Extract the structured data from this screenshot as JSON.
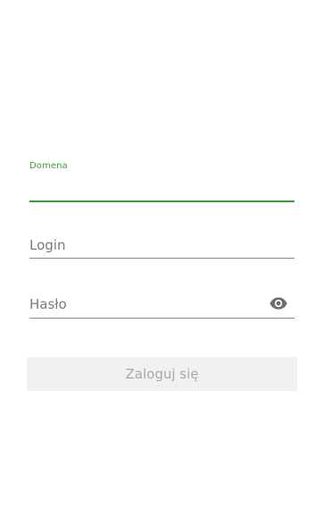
{
  "form": {
    "domain": {
      "label": "Domena",
      "value": ""
    },
    "login": {
      "placeholder": "Login",
      "value": ""
    },
    "password": {
      "placeholder": "Hasło",
      "value": "",
      "toggle_icon": "eye-icon"
    },
    "submit_label": "Zaloguj się",
    "submit_enabled": false
  },
  "colors": {
    "accent": "#3d9a3d",
    "underline": "#8a8a8a",
    "placeholder": "#7b7b7b",
    "button_bg": "#f1f1f1",
    "button_text_disabled": "#a9a9a9"
  }
}
